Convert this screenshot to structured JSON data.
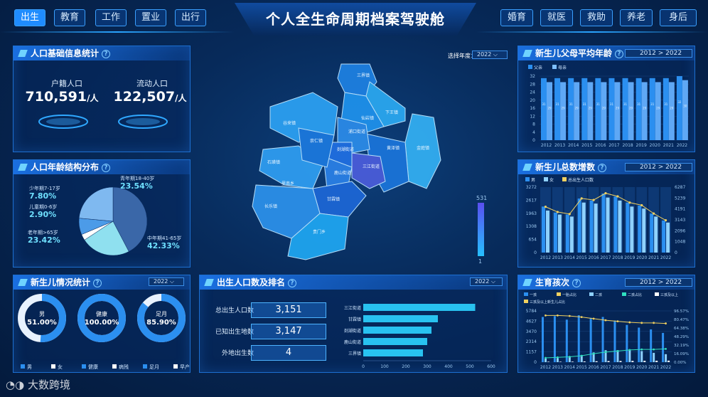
{
  "nav": {
    "left": [
      "出生",
      "教育",
      "工作",
      "置业",
      "出行"
    ],
    "right": [
      "婚育",
      "就医",
      "救助",
      "养老",
      "身后"
    ],
    "title": "个人全生命周期档案驾驶舱"
  },
  "p1": {
    "title": "人口基础信息统计",
    "a_label": "户籍人口",
    "a_value": "710,591",
    "a_unit": "/人",
    "b_label": "流动人口",
    "b_value": "122,507",
    "b_unit": "/人"
  },
  "p2": {
    "title": "人口年龄结构分布",
    "labels": [
      {
        "name": "青年期18-40岁",
        "value": "23.54"
      },
      {
        "name": "少年期7-17岁",
        "value": "7.80"
      },
      {
        "name": "儿童期0-6岁",
        "value": "2.90"
      },
      {
        "name": "老年期>65岁",
        "value": "23.42"
      },
      {
        "name": "中年期41-65岁",
        "value": "42.33"
      }
    ],
    "pct": "%"
  },
  "p3": {
    "title": "新生儿情况统计",
    "year": "2022",
    "donuts": [
      {
        "name": "男",
        "value": "51.00%"
      },
      {
        "name": "健康",
        "value": "100.00%"
      },
      {
        "name": "足月",
        "value": "85.90%"
      }
    ],
    "legend": [
      "男",
      "女",
      "健康",
      "病残",
      "足月",
      "早产"
    ]
  },
  "map": {
    "select_label": "选择年度：",
    "year": "2022",
    "scale_max": "531",
    "scale_min": "1",
    "towns": [
      "三界镇",
      "下王镇",
      "仙岩镇",
      "谷来镇",
      "浦口街道",
      "金庭镇",
      "黄泽镇",
      "三江街道",
      "剡湖街道",
      "鹿山街道",
      "甘霖镇",
      "石璜镇",
      "长乐镇",
      "崇仁镇",
      "贵门乡",
      "里南乡"
    ]
  },
  "p4": {
    "title": "出生人口数及排名",
    "year": "2022",
    "stats": [
      {
        "label": "总出生人口数",
        "value": "3,151"
      },
      {
        "label": "已知出生地数",
        "value": "3,147"
      },
      {
        "label": "外地出生数",
        "value": "4"
      }
    ]
  },
  "p5": {
    "title": "新生儿父母平均年龄",
    "from": "2012",
    "arrow": ">",
    "to": "2022",
    "legend": [
      "父亲",
      "母亲"
    ]
  },
  "p6": {
    "title": "新生儿总数增数",
    "from": "2012",
    "arrow": ">",
    "to": "2022",
    "legend": [
      "男",
      "女",
      "总出生人口数"
    ]
  },
  "p7": {
    "title": "生育孩次",
    "from": "2012",
    "arrow": ">",
    "to": "2022",
    "legend": [
      "一孩",
      "一胎占比",
      "二孩",
      "二孩占比",
      "三孩及以上",
      "三孩及以上新生儿占比"
    ]
  },
  "watermark": "大数跨境",
  "chart_data": [
    {
      "type": "pie",
      "title": "人口年龄结构分布",
      "categories": [
        "中年期41-65岁",
        "老年期>65岁",
        "儿童期0-6岁",
        "少年期7-17岁",
        "青年期18-40岁"
      ],
      "values": [
        42.33,
        23.42,
        2.9,
        7.8,
        23.54
      ]
    },
    {
      "type": "bar",
      "title": "新生儿父母平均年龄",
      "categories": [
        "2012",
        "2013",
        "2014",
        "2015",
        "2016",
        "2017",
        "2018",
        "2019",
        "2020",
        "2021",
        "2022"
      ],
      "ylim": [
        0,
        32
      ],
      "yticks": [
        0,
        4,
        8,
        12,
        16,
        20,
        24,
        28,
        32
      ],
      "series": [
        {
          "name": "父亲",
          "values": [
            31,
            31,
            31,
            31,
            31,
            31,
            31,
            31,
            31,
            31,
            32
          ]
        },
        {
          "name": "母亲",
          "values": [
            29,
            29,
            29,
            29,
            29,
            29,
            29,
            29,
            29,
            29,
            30
          ]
        }
      ]
    },
    {
      "type": "bar",
      "title": "新生儿总数增数",
      "categories": [
        "2012",
        "2013",
        "2014",
        "2015",
        "2016",
        "2017",
        "2018",
        "2019",
        "2020",
        "2021",
        "2022"
      ],
      "yleft": [
        "0",
        "654",
        "1308",
        "1963",
        "2617",
        "3272"
      ],
      "yright": [
        "0",
        "1048",
        "2096",
        "3143",
        "4191",
        "5239",
        "6287"
      ],
      "series": [
        {
          "name": "男",
          "values": [
            2300,
            2000,
            1900,
            2700,
            2600,
            2950,
            2800,
            2500,
            2350,
            1950,
            1600
          ]
        },
        {
          "name": "女",
          "values": [
            2100,
            1900,
            1800,
            2500,
            2450,
            2750,
            2600,
            2300,
            2200,
            1800,
            1500
          ]
        },
        {
          "name": "总出生人口数",
          "values": [
            4400,
            3900,
            3700,
            5200,
            5050,
            5700,
            5400,
            4800,
            4550,
            3750,
            3100
          ]
        }
      ]
    },
    {
      "type": "bar",
      "title": "生育孩次",
      "categories": [
        "2012",
        "2013",
        "2014",
        "2015",
        "2016",
        "2017",
        "2018",
        "2019",
        "2020",
        "2021",
        "2022"
      ],
      "yleft": [
        "0",
        "1157",
        "2314",
        "3470",
        "4627",
        "5784"
      ],
      "yright": [
        "0.00%",
        "16.09%",
        "32.19%",
        "48.29%",
        "64.38%",
        "80.47%",
        "96.57%"
      ],
      "series": [
        {
          "name": "一孩",
          "values": [
            5100,
            5200,
            4800,
            5300,
            5000,
            5100,
            4700,
            4200,
            3900,
            3700,
            3300
          ]
        },
        {
          "name": "二孩",
          "values": [
            400,
            450,
            600,
            800,
            1100,
            1350,
            1350,
            1400,
            1250,
            1050,
            900
          ]
        },
        {
          "name": "三孩及以上",
          "values": [
            50,
            50,
            60,
            80,
            100,
            120,
            130,
            140,
            150,
            160,
            170
          ]
        },
        {
          "name": "一胎占比",
          "values": [
            88,
            88,
            87,
            85,
            82,
            79,
            77,
            75,
            74,
            74,
            73
          ]
        },
        {
          "name": "二孩占比",
          "values": [
            8,
            9,
            10,
            12,
            16,
            19,
            21,
            23,
            24,
            24,
            25
          ]
        }
      ]
    },
    {
      "type": "bar",
      "title": "出生人口数及排名",
      "categories": [
        "三江街道",
        "甘霖镇",
        "剡湖街道",
        "鹿山街道",
        "三界镇"
      ],
      "xticks": [
        "0",
        "100",
        "200",
        "300",
        "400",
        "500",
        "600"
      ],
      "values": [
        525,
        350,
        320,
        300,
        280
      ]
    }
  ]
}
